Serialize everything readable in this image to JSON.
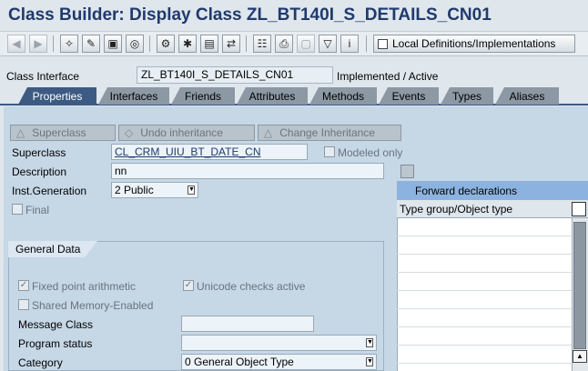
{
  "window": {
    "title": "Class Builder: Display Class ZL_BT140I_S_DETAILS_CN01"
  },
  "toolbar": {
    "buttons": [
      "back-icon",
      "forward-icon",
      "other-object-icon",
      "display-change-icon",
      "active-inactive-icon",
      "where-used-icon",
      "check-icon",
      "activate-icon",
      "test-icon",
      "display-object-list-icon",
      "hierarchy-icon",
      "print-icon",
      "empty-icon",
      "filter-icon",
      "info-icon"
    ],
    "local_def_label": "Local Definitions/Implementations"
  },
  "header": {
    "class_interface_label": "Class Interface",
    "class_interface_value": "ZL_BT140I_S_DETAILS_CN01",
    "status": "Implemented / Active"
  },
  "tabs": [
    {
      "label": "Properties",
      "active": true
    },
    {
      "label": "Interfaces",
      "active": false
    },
    {
      "label": "Friends",
      "active": false
    },
    {
      "label": "Attributes",
      "active": false
    },
    {
      "label": "Methods",
      "active": false
    },
    {
      "label": "Events",
      "active": false
    },
    {
      "label": "Types",
      "active": false
    },
    {
      "label": "Aliases",
      "active": false
    }
  ],
  "properties": {
    "superclass_button": "Superclass",
    "undo_inheritance_button": "Undo inheritance",
    "change_inheritance_button": "Change Inheritance",
    "superclass_label": "Superclass",
    "superclass_value": "CL_CRM_UIU_BT_DATE_CN",
    "modeled_only_label": "Modeled only",
    "description_label": "Description",
    "description_value": "nn",
    "inst_generation_label": "Inst.Generation",
    "inst_generation_value": "2 Public",
    "final_label": "Final"
  },
  "general_data": {
    "tab_label": "General Data",
    "fixed_point_label": "Fixed point arithmetic",
    "unicode_label": "Unicode checks active",
    "shared_memory_label": "Shared Memory-Enabled",
    "message_class_label": "Message Class",
    "message_class_value": "",
    "program_status_label": "Program status",
    "program_status_value": "",
    "category_label": "Category",
    "category_value": "0 General Object Type"
  },
  "forward_declarations": {
    "title": "Forward declarations",
    "column_header": "Type group/Object type"
  },
  "colors": {
    "accent": "#3c5a82",
    "title": "#1f3a6e",
    "panel": "#c6d7e6"
  }
}
